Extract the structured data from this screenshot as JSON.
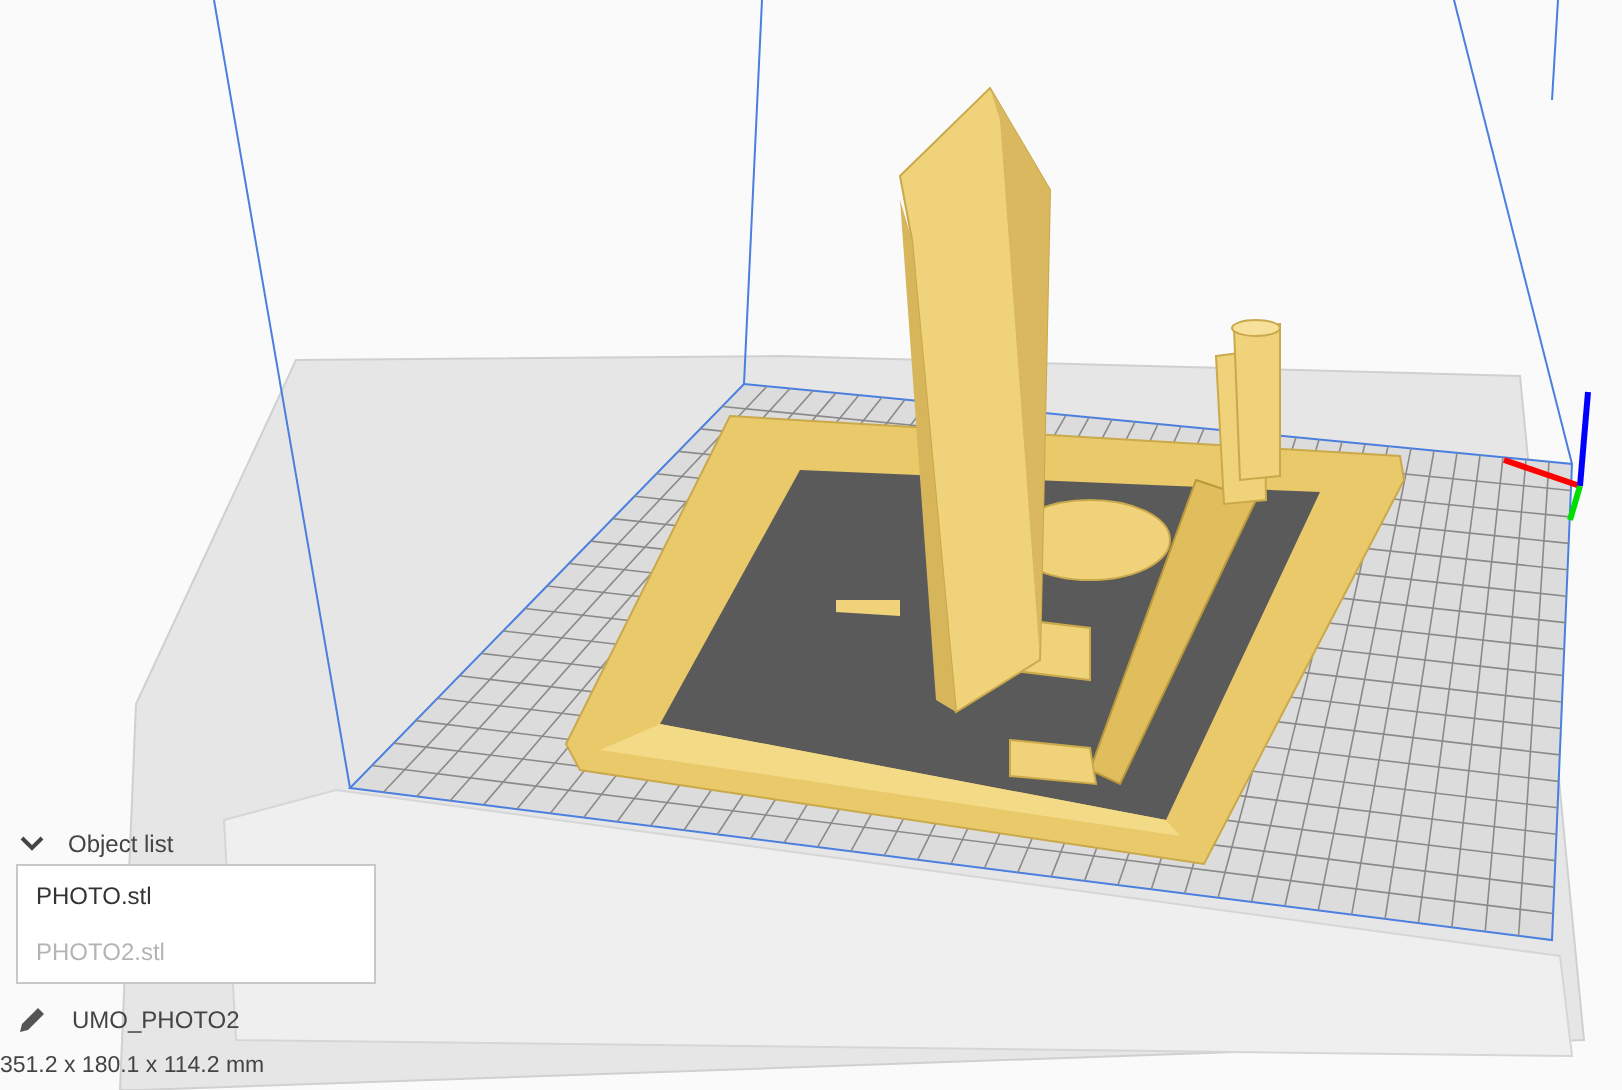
{
  "object_list": {
    "title": "Object list",
    "expanded": true,
    "items": [
      {
        "name": "PHOTO.stl",
        "disabled": false
      },
      {
        "name": "PHOTO2.stl",
        "disabled": true
      }
    ]
  },
  "job_name": "UMO_PHOTO2",
  "dimensions": "351.2 x 180.1 x 114.2 mm"
}
